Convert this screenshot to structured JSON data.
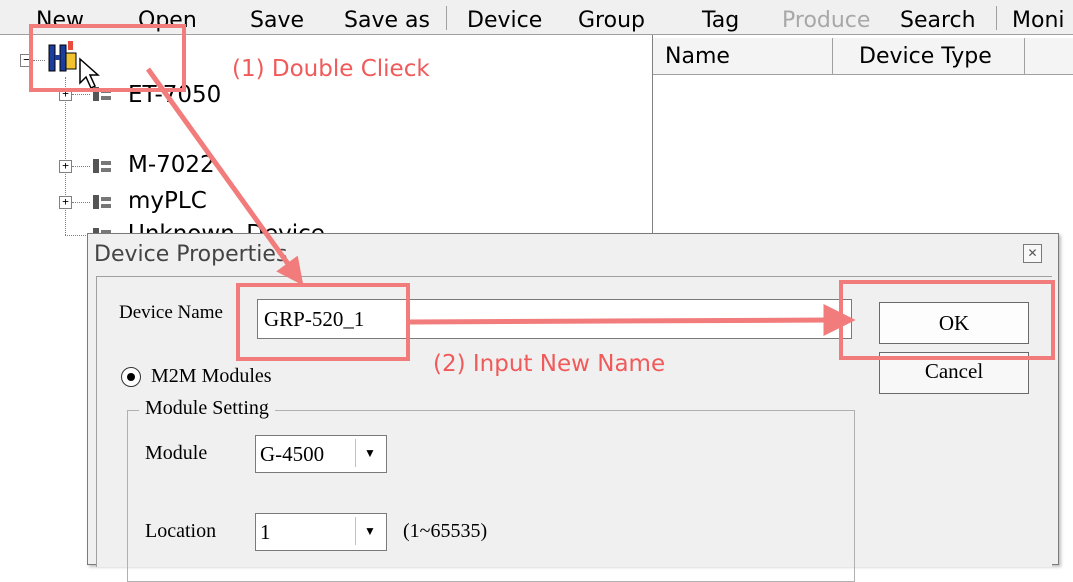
{
  "menu": {
    "new": "New",
    "open": "Open",
    "save": "Save",
    "save_as": "Save as",
    "device": "Device",
    "group": "Group",
    "tag": "Tag",
    "produce": "Produce",
    "search": "Search",
    "moni": "Moni"
  },
  "tree": {
    "items": [
      {
        "label": "ET-7050"
      },
      {
        "label": "M-7022"
      },
      {
        "label": "myPLC"
      },
      {
        "label": "Unknown_Device"
      }
    ]
  },
  "list": {
    "columns": [
      "Name",
      "Device Type"
    ]
  },
  "dialog": {
    "title": "Device Properties",
    "device_name_label": "Device Name",
    "device_name_value": "GRP-520_1",
    "ok_label": "OK",
    "cancel_label": "Cancel",
    "radio_label": "M2M Modules",
    "group_title": "Module Setting",
    "module_label": "Module",
    "module_value": "G-4500",
    "location_label": "Location",
    "location_value": "1",
    "location_range": "(1~65535)"
  },
  "annotations": {
    "step1": "(1) Double Clieck",
    "step2": "(2) Input New Name",
    "color": "#f05a5a"
  }
}
